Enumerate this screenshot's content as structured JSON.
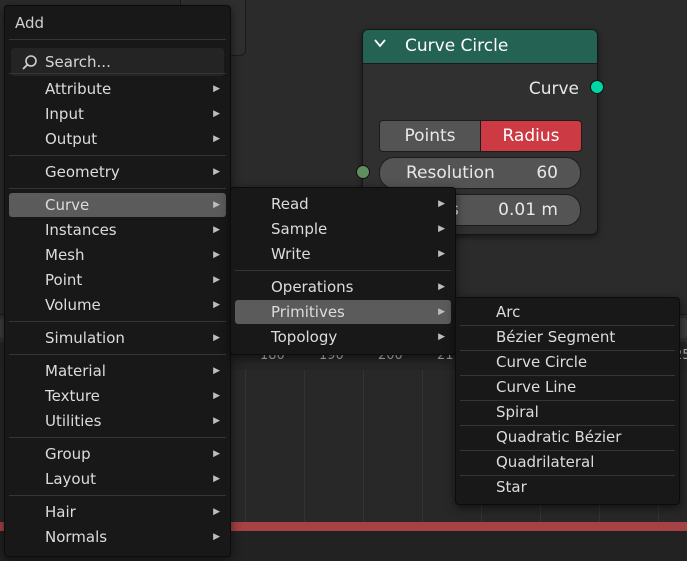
{
  "timeline": {
    "ticks": [
      "180",
      "190",
      "200",
      "21",
      "25"
    ]
  },
  "node": {
    "title": "Curve Circle",
    "output_label": "Curve",
    "mode_points": "Points",
    "mode_radius": "Radius",
    "resolution_label": "Resolution",
    "resolution_value": "60",
    "radius_label": "s",
    "radius_value": "0.01 m",
    "header_color": "#246254",
    "socket_color": "#00d6a3"
  },
  "add_menu": {
    "title": "Add",
    "search_placeholder": "Search...",
    "items": [
      "Attribute",
      "Input",
      "Output",
      "Geometry",
      "Curve",
      "Instances",
      "Mesh",
      "Point",
      "Volume",
      "Simulation",
      "Material",
      "Texture",
      "Utilities",
      "Group",
      "Layout",
      "Hair",
      "Normals"
    ]
  },
  "curve_menu": {
    "items": [
      "Read",
      "Sample",
      "Write",
      "Operations",
      "Primitives",
      "Topology"
    ]
  },
  "primitives_menu": {
    "items": [
      "Arc",
      "Bézier Segment",
      "Curve Circle",
      "Curve Line",
      "Spiral",
      "Quadratic Bézier",
      "Quadrilateral",
      "Star"
    ]
  }
}
